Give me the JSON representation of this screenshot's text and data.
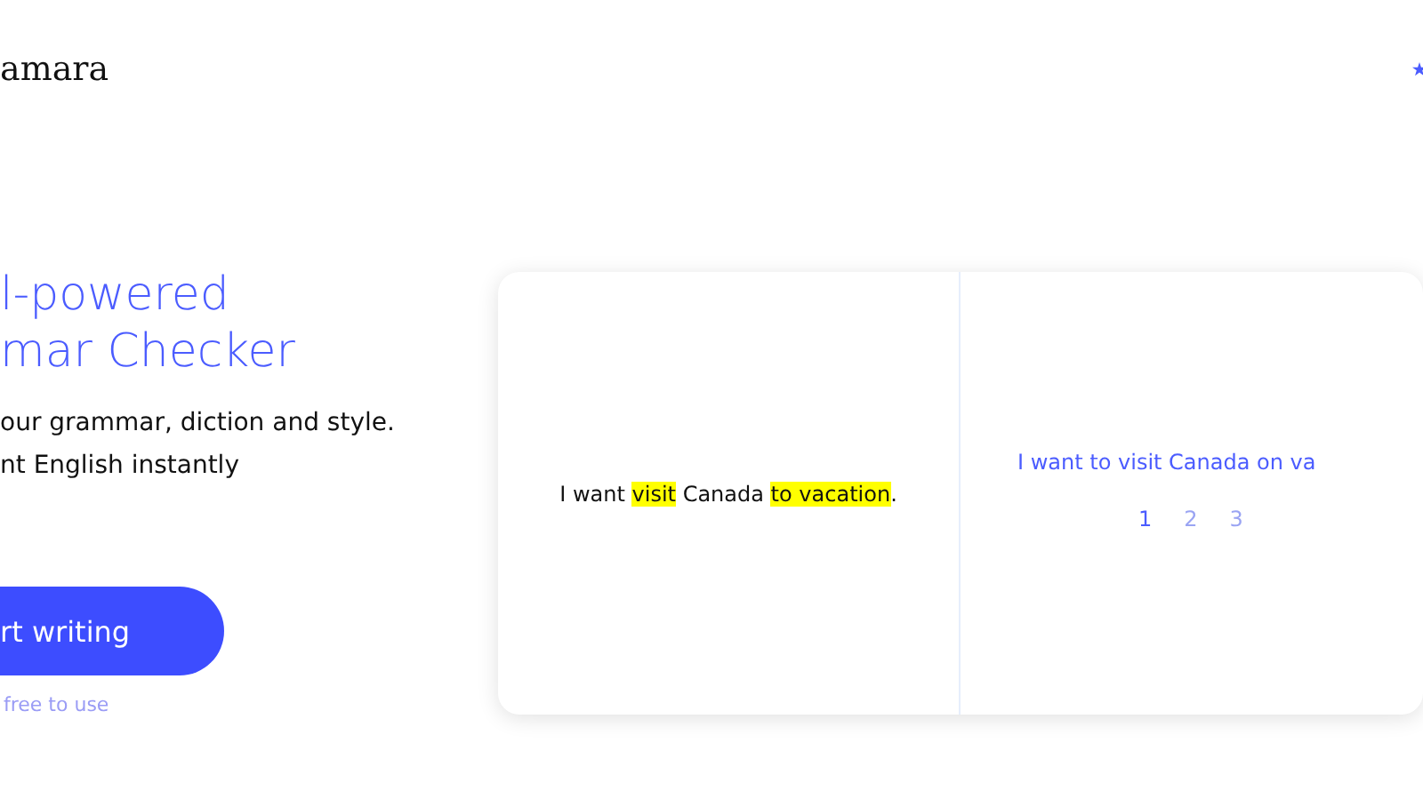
{
  "header": {
    "logo": "amara"
  },
  "hero": {
    "title_lines": [
      "l-powered",
      "mar Checker"
    ],
    "subtitle_lines": [
      "our grammar, diction and style.",
      "nt English instantly"
    ],
    "cta": "rt writing",
    "note": "free to use"
  },
  "demo": {
    "original": [
      {
        "text": "I want ",
        "highlighted": false
      },
      {
        "text": "visit",
        "highlighted": true
      },
      {
        "text": " Canada ",
        "highlighted": false
      },
      {
        "text": "to vacation",
        "highlighted": true
      },
      {
        "text": ".",
        "highlighted": false
      }
    ],
    "correction": "I want to visit Canada on va",
    "pages": [
      {
        "label": "1",
        "selected": true
      },
      {
        "label": "2",
        "selected": false
      },
      {
        "label": "3",
        "selected": false
      }
    ]
  }
}
